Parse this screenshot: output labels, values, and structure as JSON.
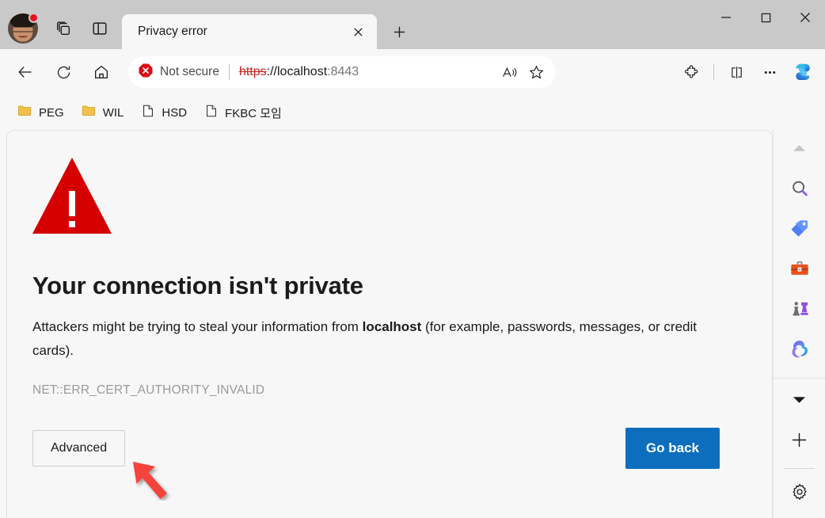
{
  "window": {
    "titlebar": {
      "avatar": "profile-avatar",
      "avatar_badge": "notification-dot",
      "tab_stack_icon": "tab-stack-icon",
      "split_panel_icon": "browser-essentials-icon",
      "tabs": [
        {
          "title": "Privacy error",
          "close_label": "✕",
          "active": true
        }
      ],
      "new_tab_label": "+",
      "controls": {
        "minimize": "—",
        "maximize": "□",
        "close": "✕"
      }
    },
    "toolbar": {
      "back_icon": "back-arrow-icon",
      "refresh_icon": "refresh-icon",
      "home_icon": "home-icon",
      "security": {
        "icon": "not-secure-icon",
        "label": "Not secure",
        "color": "#d90d15"
      },
      "url": {
        "scheme": "https",
        "separator": "://",
        "host": "localhost",
        "port": ":8443",
        "full": "https://localhost:8443"
      },
      "read_aloud_icon": "read-aloud-icon",
      "favorite_icon": "star-favorite-icon",
      "extensions_icon": "extensions-puzzle-icon",
      "split_screen_icon": "split-screen-icon",
      "more_icon": "ellipsis-more-icon",
      "copilot_icon": "copilot-icon"
    },
    "bookmarks": [
      {
        "label": "PEG",
        "icon": "folder-icon"
      },
      {
        "label": "WIL",
        "icon": "folder-icon"
      },
      {
        "label": "HSD",
        "icon": "page-icon"
      },
      {
        "label": "FKBC 모임",
        "icon": "page-icon"
      }
    ]
  },
  "page": {
    "warning_icon": "warning-triangle-icon",
    "warning_color": "#d50000",
    "title": "Your connection isn't private",
    "body_before": "Attackers might be trying to steal your information from ",
    "body_host": "localhost",
    "body_after": " (for example, passwords, messages, or credit cards).",
    "error_code": "NET::ERR_CERT_AUTHORITY_INVALID",
    "advanced_button": "Advanced",
    "goback_button": "Go back",
    "goback_color": "#0c6ebd",
    "annotation_arrow": "red-pointer-arrow"
  },
  "sidebar": {
    "items": [
      {
        "name": "collapse-chevron-up-icon",
        "label": ""
      },
      {
        "name": "search-icon",
        "label": ""
      },
      {
        "name": "shopping-tag-icon",
        "label": ""
      },
      {
        "name": "tools-toolbox-icon",
        "label": ""
      },
      {
        "name": "games-chess-icon",
        "label": ""
      },
      {
        "name": "office-icon",
        "label": ""
      },
      {
        "name": "expand-chevron-down-icon",
        "label": ""
      },
      {
        "name": "add-plus-icon",
        "label": ""
      },
      {
        "name": "settings-gear-icon",
        "label": ""
      }
    ]
  }
}
